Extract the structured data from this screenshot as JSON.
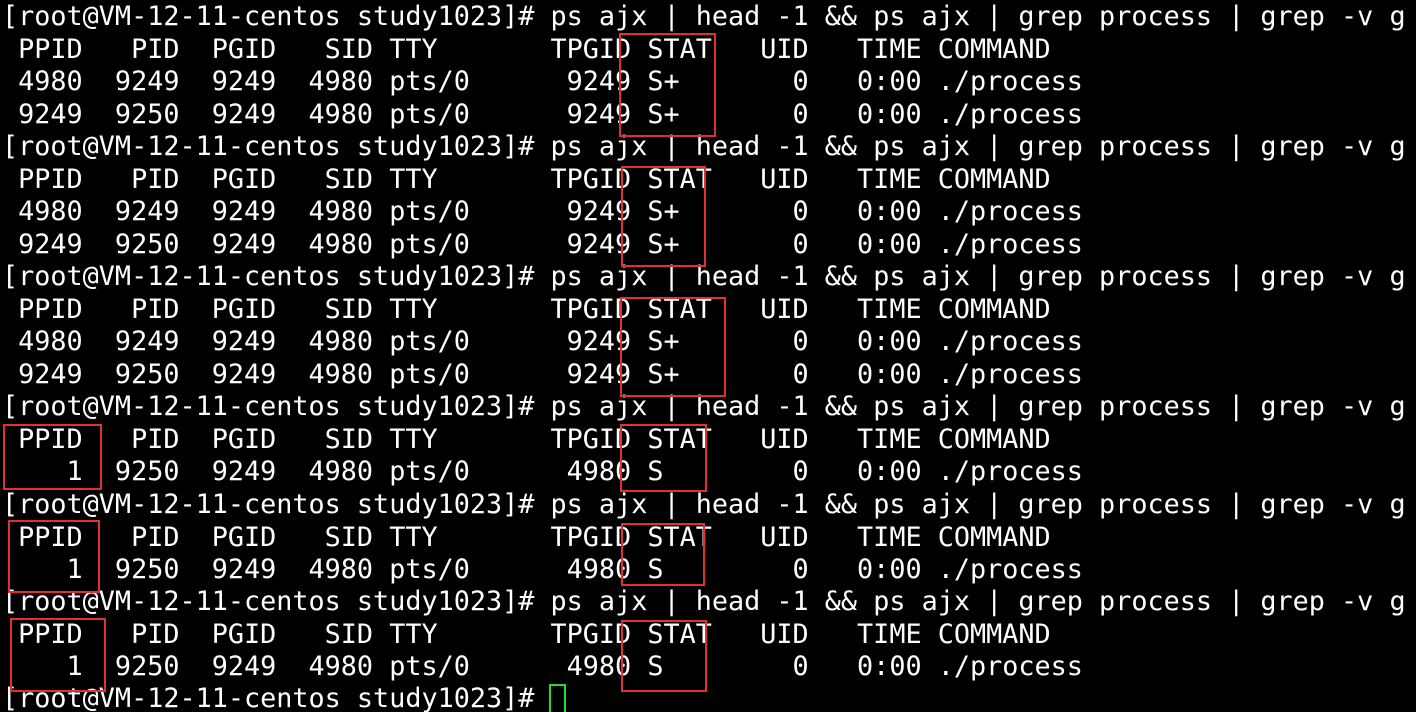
{
  "terminal": {
    "prompt": "[root@VM-12-11-centos study1023]# ",
    "command": "ps ajx | head -1 && ps ajx | grep process | grep -v g",
    "header": " PPID   PID  PGID   SID TTY       TPGID STAT   UID   TIME COMMAND",
    "blocks": [
      {
        "rows": [
          " 4980  9249  9249  4980 pts/0      9249 S+       0   0:00 ./process",
          " 9249  9250  9249  4980 pts/0      9249 S+       0   0:00 ./process"
        ]
      },
      {
        "rows": [
          " 4980  9249  9249  4980 pts/0      9249 S+       0   0:00 ./process",
          " 9249  9250  9249  4980 pts/0      9249 S+       0   0:00 ./process"
        ]
      },
      {
        "rows": [
          " 4980  9249  9249  4980 pts/0      9249 S+       0   0:00 ./process",
          " 9249  9250  9249  4980 pts/0      9249 S+       0   0:00 ./process"
        ]
      },
      {
        "rows": [
          "    1  9250  9249  4980 pts/0      4980 S        0   0:00 ./process"
        ]
      },
      {
        "rows": [
          "    1  9250  9249  4980 pts/0      4980 S        0   0:00 ./process"
        ]
      },
      {
        "rows": [
          "    1  9250  9249  4980 pts/0      4980 S        0   0:00 ./process"
        ]
      }
    ],
    "final_prompt": "[root@VM-12-11-centos study1023]# ",
    "colors": {
      "background": "#000000",
      "text": "#ffffff",
      "highlight_box": "#e03030",
      "cursor": "#22dd22"
    }
  }
}
